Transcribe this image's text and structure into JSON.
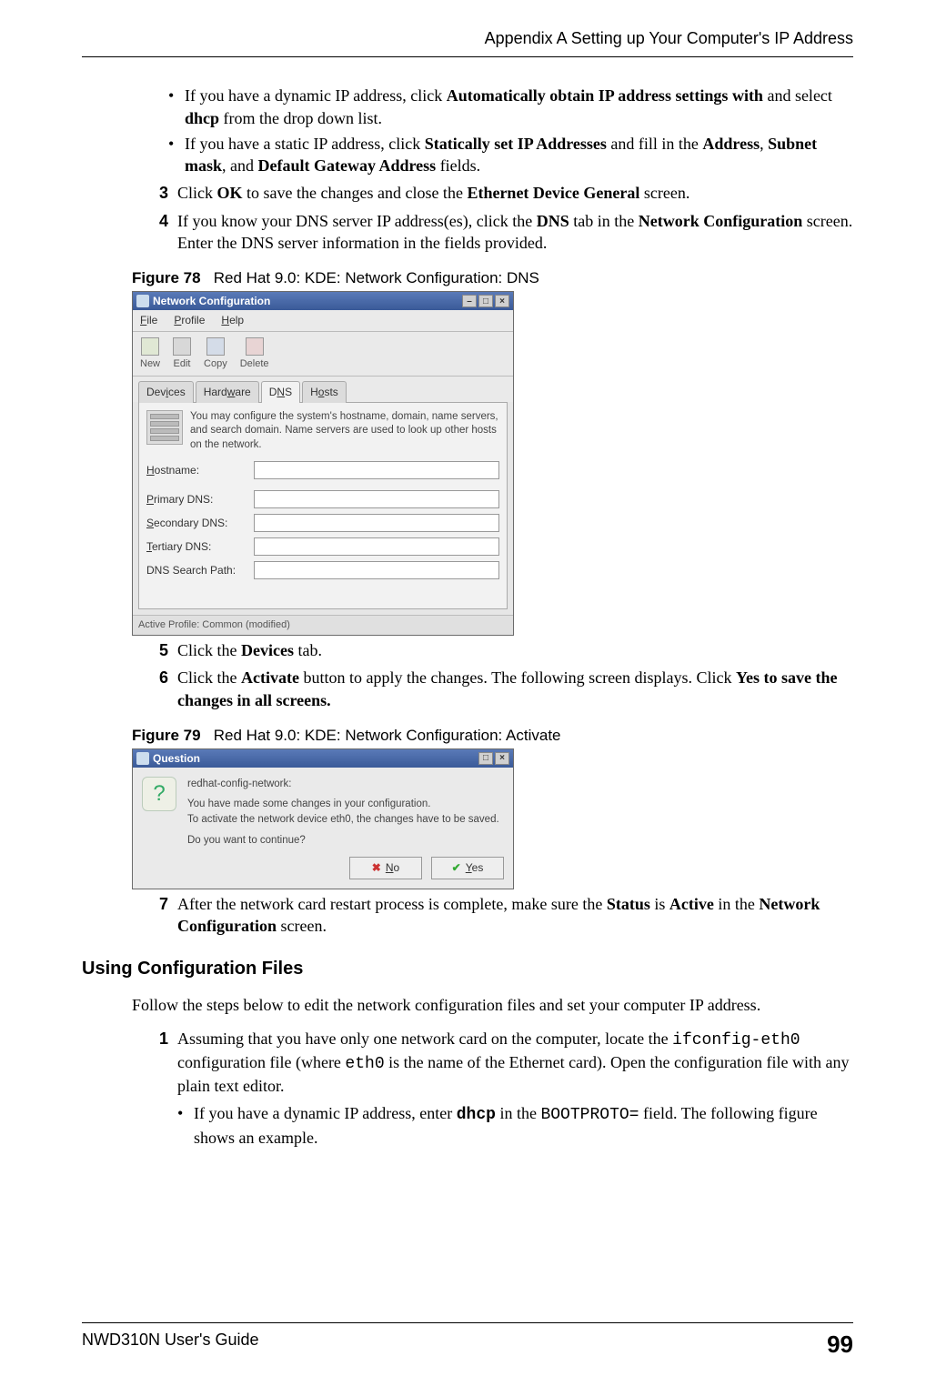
{
  "header": {
    "appendix_title": "Appendix A Setting up Your Computer's IP Address"
  },
  "body": {
    "bullet1": {
      "pre": "If you have a dynamic IP address, click ",
      "bold1": "Automatically obtain IP address settings with",
      "mid1": " and select ",
      "bold2": "dhcp",
      "post": " from the drop down list."
    },
    "bullet2": {
      "pre": "If you have a static IP address, click ",
      "bold1": "Statically set IP Addresses",
      "mid1": " and fill in the ",
      "bold2": "Address",
      "sep1": ", ",
      "bold3": "Subnet mask",
      "sep2": ", and ",
      "bold4": "Default Gateway Address",
      "post": " fields."
    },
    "step3": {
      "num": "3",
      "pre": "Click ",
      "bold1": "OK",
      "mid1": " to save the changes and close the ",
      "bold2": "Ethernet Device General",
      "post": " screen."
    },
    "step4": {
      "num": "4",
      "pre": "If you know your DNS server IP address(es), click the ",
      "bold1": "DNS",
      "mid1": " tab in the ",
      "bold2": "Network Configuration",
      "post": " screen. Enter the DNS server information in the fields provided."
    },
    "fig78": {
      "label": "Figure 78",
      "caption": "Red Hat 9.0: KDE: Network Configuration: DNS"
    },
    "netcfg": {
      "title": "Network Configuration",
      "menu": {
        "file": "File",
        "profile": "Profile",
        "help": "Help"
      },
      "tools": {
        "new": "New",
        "edit": "Edit",
        "copy": "Copy",
        "delete": "Delete"
      },
      "tabs": {
        "devices": "Devices",
        "hardware": "Hardware",
        "dns": "DNS",
        "hosts": "Hosts"
      },
      "info": "You may configure the system's hostname, domain, name servers, and search domain. Name servers are used to look up other hosts on the network.",
      "fields": {
        "hostname": "Hostname:",
        "primary": "Primary DNS:",
        "secondary": "Secondary DNS:",
        "tertiary": "Tertiary DNS:",
        "search": "DNS Search Path:"
      },
      "status": "Active Profile: Common (modified)"
    },
    "step5": {
      "num": "5",
      "pre": "Click the ",
      "bold1": "Devices",
      "post": " tab."
    },
    "step6": {
      "num": "6",
      "pre": "Click the ",
      "bold1": "Activate",
      "mid1": " button to apply the changes. The following screen displays. Click ",
      "bold2": "Yes to save the changes in all screens."
    },
    "fig79": {
      "label": "Figure 79",
      "caption": "Red Hat 9.0: KDE: Network Configuration: Activate"
    },
    "qdlg": {
      "title": "Question",
      "line1": "redhat-config-network:",
      "line2": "You have made some changes in your configuration.",
      "line3": "To activate the network device eth0, the changes have to be saved.",
      "line4": "Do you want to continue?",
      "no": "No",
      "yes": "Yes"
    },
    "step7": {
      "num": "7",
      "pre": "After the network card restart process is complete, make sure the ",
      "bold1": "Status",
      "mid1": " is ",
      "bold2": "Active",
      "mid2": " in the ",
      "bold3": "Network Configuration",
      "post": " screen."
    },
    "section_heading": "Using Configuration Files",
    "intro": "Follow the steps below to edit the network configuration files and set your computer IP address.",
    "cstep1": {
      "num": "1",
      "pre": "Assuming that you have only one network card on the computer, locate the ",
      "mono1": "ifconfig-eth0",
      "mid1": " configuration file (where ",
      "mono2": "eth0",
      "mid2": " is the name of the Ethernet card). Open the configuration file with any plain text editor."
    },
    "cbullet1": {
      "pre": "If you have a dynamic IP address, enter ",
      "monobold": "dhcp",
      "mid1": " in the ",
      "mono1": "BOOTPROTO=",
      "post": " field.  The following figure shows an example."
    }
  },
  "footer": {
    "guide": "NWD310N User's Guide",
    "page": "99"
  }
}
